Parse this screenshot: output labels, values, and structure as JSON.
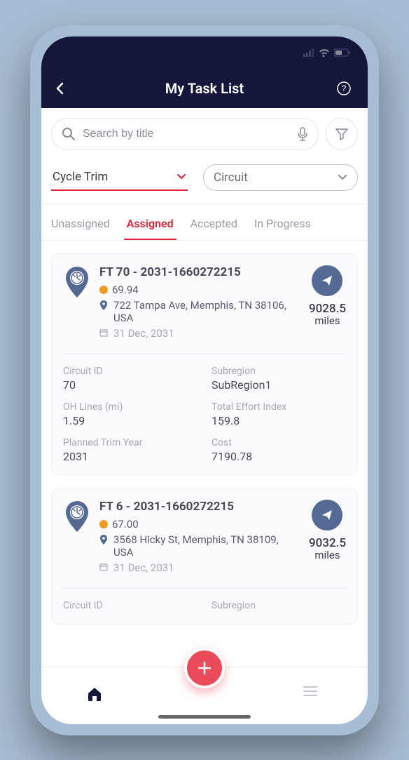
{
  "header": {
    "title": "My Task List"
  },
  "search": {
    "placeholder": "Search by title"
  },
  "filters": {
    "category": "Cycle Trim",
    "group_by": "Circuit"
  },
  "tabs": [
    "Unassigned",
    "Assigned",
    "Accepted",
    "In Progress"
  ],
  "active_tab_index": 1,
  "cards": [
    {
      "title": "FT 70 - 2031-1660272215",
      "score": "69.94",
      "address": "722 Tampa Ave, Memphis, TN 38106, USA",
      "date": "31 Dec, 2031",
      "distance": "9028.5",
      "distance_unit": "miles",
      "details": {
        "circuit_id_label": "Circuit ID",
        "circuit_id": "70",
        "subregion_label": "Subregion",
        "subregion": "SubRegion1",
        "oh_lines_label": "OH Lines (mi)",
        "oh_lines": "1.59",
        "tei_label": "Total Effort Index",
        "tei": "159.8",
        "planned_trim_label": "Planned Trim Year",
        "planned_trim": "2031",
        "cost_label": "Cost",
        "cost": "7190.78"
      }
    },
    {
      "title": "FT 6 - 2031-1660272215",
      "score": "67.00",
      "address": "3568 Hicky St, Memphis, TN 38109, USA",
      "date": "31 Dec, 2031",
      "distance": "9032.5",
      "distance_unit": "miles",
      "details": {
        "circuit_id_label": "Circuit ID",
        "circuit_id": "",
        "subregion_label": "Subregion",
        "subregion": ""
      }
    }
  ]
}
